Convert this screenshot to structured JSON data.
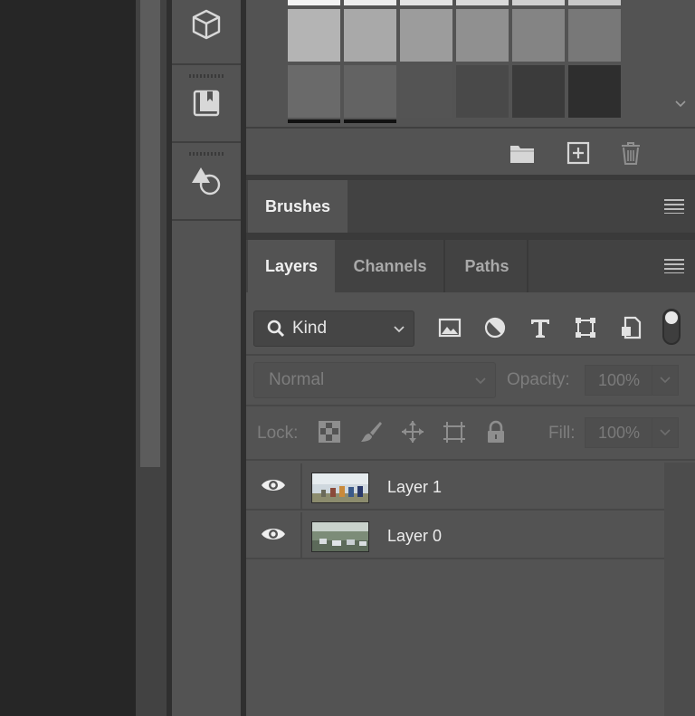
{
  "swatches": {
    "rows": [
      [
        "#f2f2f2",
        "#ececec",
        "#e3e3e3",
        "#dadada",
        "#d0d0d0",
        "#c8c8c8"
      ],
      [
        "#b4b4b4",
        "#a9a9a9",
        "#9c9c9c",
        "#909090",
        "#848484",
        "#787878"
      ],
      [
        "#6a6a6a",
        "#636363",
        "#545454",
        "#494949",
        "#3b3b3b",
        "#2e2e2e"
      ]
    ],
    "toolbar_icons": [
      "folder-icon",
      "new-swatch-icon",
      "trash-icon"
    ]
  },
  "tools": [
    "3d-cube-icon",
    "libraries-icon",
    "shapes-icon"
  ],
  "brushes": {
    "tab_label": "Brushes"
  },
  "layers": {
    "tabs": [
      {
        "label": "Layers",
        "active": true
      },
      {
        "label": "Channels",
        "active": false
      },
      {
        "label": "Paths",
        "active": false
      }
    ],
    "filter": {
      "kind_label": "Kind",
      "icons": [
        "image-filter-icon",
        "adjustment-filter-icon",
        "type-filter-icon",
        "shape-filter-icon",
        "smart-object-filter-icon"
      ]
    },
    "blend_mode": "Normal",
    "opacity_label": "Opacity:",
    "opacity_value": "100%",
    "lock_label": "Lock:",
    "lock_icons": [
      "lock-transparent-pixels-icon",
      "lock-image-pixels-icon",
      "lock-position-icon",
      "lock-artboard-icon",
      "lock-all-icon"
    ],
    "fill_label": "Fill:",
    "fill_value": "100%",
    "list": [
      {
        "name": "Layer 1",
        "visible": true
      },
      {
        "name": "Layer 0",
        "visible": true
      }
    ]
  },
  "colors": {
    "panel_bg": "#535353",
    "tab_bar_bg": "#424242",
    "canvas_bg": "#262626"
  }
}
